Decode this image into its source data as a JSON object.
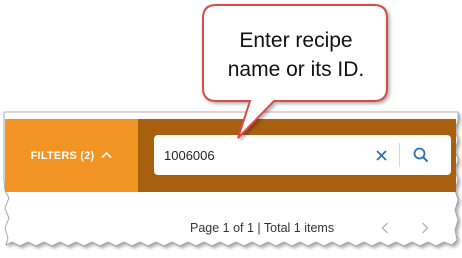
{
  "filters": {
    "label": "FILTERS (2)",
    "icon": "chevron-up-icon"
  },
  "search": {
    "value": "1006006",
    "clear_icon": "close-icon",
    "search_icon": "search-icon"
  },
  "pagination": {
    "info": "Page 1 of 1 | Total 1 items",
    "prev_icon": "chevron-left-icon",
    "next_icon": "chevron-right-icon"
  },
  "callout": {
    "line1": "Enter recipe",
    "line2": "name or its ID."
  },
  "colors": {
    "filters_bg": "#f29423",
    "search_bg": "#a8600f",
    "accent_blue": "#2f6fb3",
    "callout_border": "#d94a4a"
  }
}
